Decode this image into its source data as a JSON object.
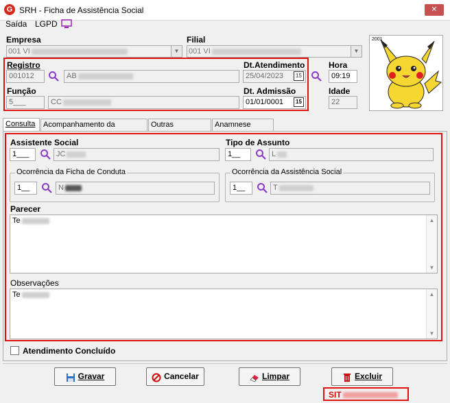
{
  "window": {
    "title": "SRH - Ficha de Assistência Social",
    "close_glyph": "✕",
    "app_icon_glyph": "G"
  },
  "menu": {
    "items": [
      "Saída",
      "LGPD"
    ]
  },
  "header": {
    "empresa_label": "Empresa",
    "empresa_value": "001 VI",
    "filial_label": "Filial",
    "filial_value": "001 VI",
    "registro_label": "Registro",
    "registro_value": "001012",
    "nome_value": "AB",
    "dt_atendimento_label": "Dt.Atendimento",
    "dt_atendimento_value": "25/04/2023",
    "hora_label": "Hora",
    "hora_value": "09:19",
    "funcao_label": "Função",
    "funcao_value": "5___",
    "funcao_desc_value": "CC",
    "dt_admissao_label": "Dt. Admissão",
    "dt_admissao_value": "01/01/0001",
    "idade_label": "Idade",
    "idade_value": "22",
    "calendar_glyph": "15",
    "photo_caption": "2001"
  },
  "tabs": [
    "Consulta",
    "Acompanhamento da Consulta",
    "Outras Consultas",
    "Anamnese Social"
  ],
  "consulta": {
    "assistente_label": "Assistente Social",
    "assistente_code": "1___",
    "assistente_name": "JC",
    "tipo_label": "Tipo de Assunto",
    "tipo_code": "1__",
    "tipo_name": "L",
    "ocorr_ficha_label": "Ocorrência da Ficha de Conduta",
    "ocorr_ficha_code": "1__",
    "ocorr_ficha_name": "N",
    "ocorr_assist_label": "Ocorrência da Assistência Social",
    "ocorr_assist_code": "1__",
    "ocorr_assist_name": "T",
    "parecer_label": "Parecer",
    "parecer_text": "Te",
    "observacoes_label": "Observações",
    "observacoes_text": "Te",
    "concluido_label": "Atendimento Concluído"
  },
  "buttons": {
    "gravar": "Gravar",
    "cancelar": "Cancelar",
    "limpar": "Limpar",
    "excluir": "Excluir"
  },
  "status": {
    "text": "SIT"
  },
  "colors": {
    "highlight": "#e01010",
    "accent": "#c75050"
  }
}
